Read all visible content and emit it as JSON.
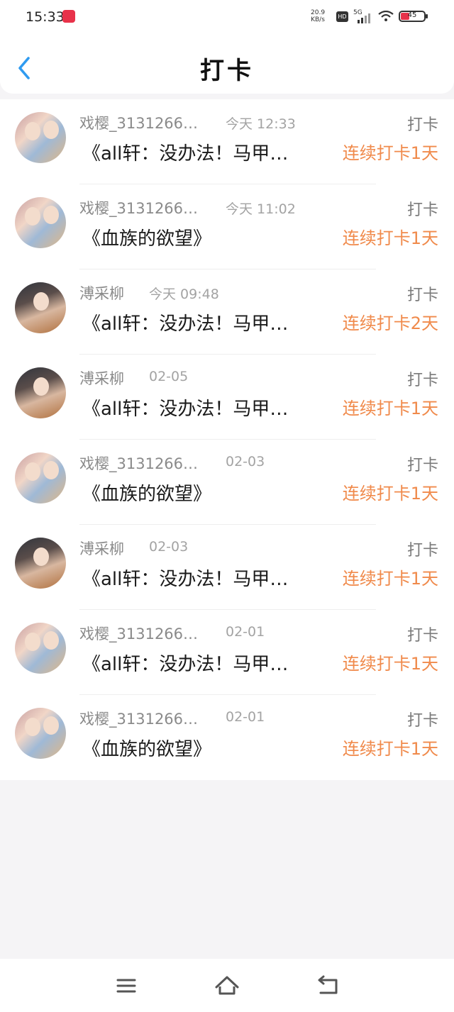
{
  "status_bar": {
    "time": "15:33",
    "speed_value": "20.9",
    "speed_unit": "KB/s",
    "hd": "HD",
    "network": "5G",
    "battery": "45"
  },
  "header": {
    "title": "打卡"
  },
  "checkins": [
    {
      "avatar": "boys",
      "user": "戏樱_3131266…",
      "time": "今天 12:33",
      "type": "打卡",
      "book": "《all轩：没办法！马甲…",
      "streak": "连续打卡1天"
    },
    {
      "avatar": "boys",
      "user": "戏樱_3131266…",
      "time": "今天 11:02",
      "type": "打卡",
      "book": "《血族的欲望》",
      "streak": "连续打卡1天"
    },
    {
      "avatar": "girl",
      "user": "溥采柳",
      "time": "今天 09:48",
      "type": "打卡",
      "book": "《all轩：没办法！马甲…",
      "streak": "连续打卡2天"
    },
    {
      "avatar": "girl",
      "user": "溥采柳",
      "time": "02-05",
      "type": "打卡",
      "book": "《all轩：没办法！马甲…",
      "streak": "连续打卡1天"
    },
    {
      "avatar": "boys",
      "user": "戏樱_3131266…",
      "time": "02-03",
      "type": "打卡",
      "book": "《血族的欲望》",
      "streak": "连续打卡1天"
    },
    {
      "avatar": "girl",
      "user": "溥采柳",
      "time": "02-03",
      "type": "打卡",
      "book": "《all轩：没办法！马甲…",
      "streak": "连续打卡1天"
    },
    {
      "avatar": "boys",
      "user": "戏樱_3131266…",
      "time": "02-01",
      "type": "打卡",
      "book": "《all轩：没办法！马甲…",
      "streak": "连续打卡1天"
    },
    {
      "avatar": "boys",
      "user": "戏樱_3131266…",
      "time": "02-01",
      "type": "打卡",
      "book": "《血族的欲望》",
      "streak": "连续打卡1天"
    }
  ],
  "colors": {
    "accent": "#2f9bf0",
    "streak": "#f08a4b",
    "background": "#f5f4f6"
  },
  "icons": {
    "back": "chevron-left-icon",
    "menu": "menu-icon",
    "home": "home-icon",
    "return": "return-icon"
  }
}
